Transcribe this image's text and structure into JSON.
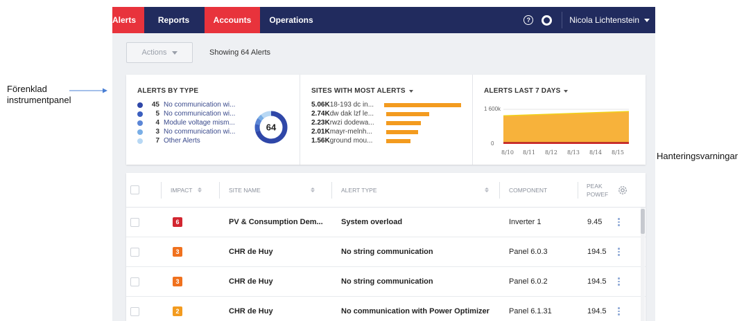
{
  "annotations": {
    "left_line1": "Förenklad",
    "left_line2": "instrumentpanel",
    "right": "Hanteringsvarningar"
  },
  "nav": {
    "tabs": [
      "Alerts",
      "Reports",
      "Accounts",
      "Operations"
    ],
    "help_icon": "?",
    "user": "Nicola Lichtenstein"
  },
  "toolbar": {
    "actions_label": "Actions",
    "showing_label": "Showing 64 Alerts"
  },
  "alerts_by_type": {
    "title": "ALERTS BY TYPE",
    "total": "64",
    "items": [
      {
        "count": "45",
        "label": "No communication wi...",
        "color": "#2f47a8"
      },
      {
        "count": "5",
        "label": "No communication wi...",
        "color": "#3b5fbf"
      },
      {
        "count": "4",
        "label": "Module voltage mism...",
        "color": "#5b86d6"
      },
      {
        "count": "3",
        "label": "No communication wi...",
        "color": "#79aee6"
      },
      {
        "count": "7",
        "label": "Other Alerts",
        "color": "#b8d8f4"
      }
    ]
  },
  "sites_most_alerts": {
    "title": "SITES WITH MOST ALERTS",
    "items": [
      {
        "value": "5.06K",
        "name": "18-193 dc in...",
        "fraction": 1.0
      },
      {
        "value": "2.74K",
        "name": "dw dak lzf le...",
        "fraction": 0.54
      },
      {
        "value": "2.23K",
        "name": "rwzi dodewa...",
        "fraction": 0.44
      },
      {
        "value": "2.01K",
        "name": "mayr-melnh...",
        "fraction": 0.4
      },
      {
        "value": "1.56K",
        "name": "ground mou...",
        "fraction": 0.31
      }
    ]
  },
  "alerts_last_7_days": {
    "title": "ALERTS LAST 7 DAYS",
    "y_ticks": [
      "1 600k",
      "0"
    ],
    "x_ticks": [
      "8/10",
      "8/11",
      "8/12",
      "8/13",
      "8/14",
      "8/15"
    ]
  },
  "chart_data": {
    "type": "area",
    "title": "ALERTS LAST 7 DAYS",
    "x": [
      "8/10",
      "8/11",
      "8/12",
      "8/13",
      "8/14",
      "8/15"
    ],
    "ylim": [
      0,
      1600000
    ],
    "series": [
      {
        "values": [
          1300000,
          1340000,
          1380000,
          1420000,
          1460000,
          1500000
        ],
        "color": "#f7b23b"
      },
      {
        "values": [
          60000,
          60000,
          60000,
          60000,
          60000,
          60000
        ],
        "color": "#d62728"
      }
    ]
  },
  "table": {
    "headers": {
      "impact": "IMPACT",
      "site": "SITE NAME",
      "type": "ALERT TYPE",
      "component": "COMPONENT",
      "peak_line1": "PEAK",
      "peak_line2": "POWEF"
    },
    "rows": [
      {
        "impact": "6",
        "impact_color": "#d22630",
        "site": "PV & Consumption Dem...",
        "type": "System overload",
        "component": "Inverter 1",
        "peak": "9.45"
      },
      {
        "impact": "3",
        "impact_color": "#f0711e",
        "site": "CHR de Huy",
        "type": "No string communication",
        "component": "Panel 6.0.3",
        "peak": "194.5"
      },
      {
        "impact": "3",
        "impact_color": "#f0711e",
        "site": "CHR de Huy",
        "type": "No string communication",
        "component": "Panel 6.0.2",
        "peak": "194.5"
      },
      {
        "impact": "2",
        "impact_color": "#f39b1f",
        "site": "CHR de Huy",
        "type": "No communication with Power Optimizer",
        "component": "Panel 6.1.31",
        "peak": "194.5"
      }
    ]
  }
}
